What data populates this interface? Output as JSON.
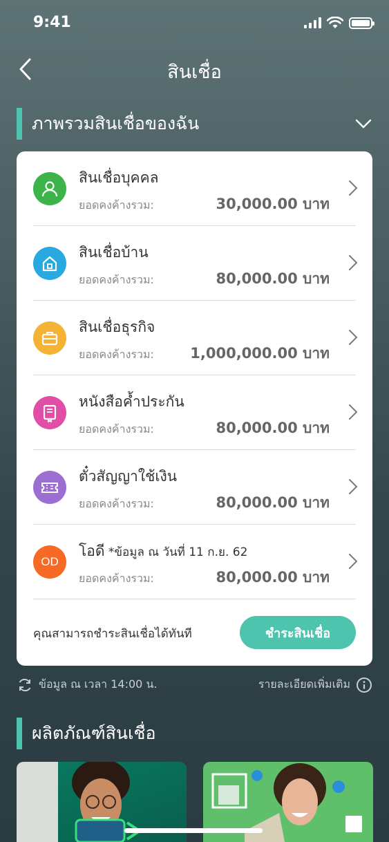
{
  "status_bar": {
    "time": "9:41"
  },
  "nav": {
    "title": "สินเชื่อ"
  },
  "overview": {
    "title": "ภาพรวมสินเชื่อของฉัน",
    "loans": [
      {
        "name": "สินเชื่อบุคคล",
        "note": "",
        "label": "ยอดคงค้างรวม:",
        "value": "30,000.00 บาท",
        "icon": "person-icon",
        "color": "#3db44a"
      },
      {
        "name": "สินเชื่อบ้าน",
        "note": "",
        "label": "ยอดคงค้างรวม:",
        "value": "80,000.00 บาท",
        "icon": "house-icon",
        "color": "#2aa9e0"
      },
      {
        "name": "สินเชื่อธุรกิจ",
        "note": "",
        "label": "ยอดคงค้างรวม:",
        "value": "1,000,000.00 บาท",
        "icon": "briefcase-icon",
        "color": "#f5b335"
      },
      {
        "name": "หนังสือค้ำประกัน",
        "note": "",
        "label": "ยอดคงค้างรวม:",
        "value": "80,000.00 บาท",
        "icon": "certificate-icon",
        "color": "#e04ea5"
      },
      {
        "name": "ตั๋วสัญญาใช้เงิน",
        "note": "",
        "label": "ยอดคงค้างรวม:",
        "value": "80,000.00 บาท",
        "icon": "ticket-icon",
        "color": "#9b6fd1"
      },
      {
        "name": "โอดี",
        "note": " *ข้อมูล ณ วันที่ 11 ก.ย. 62",
        "label": "ยอดคงค้างรวม:",
        "value": "80,000.00 บาท",
        "icon": "od-icon",
        "icon_text": "OD",
        "color": "#f76a25"
      }
    ],
    "pay_text": "คุณสามารถชำระสินเชื่อได้ทันที",
    "pay_button": "ชำระสินเชื่อ"
  },
  "info": {
    "updated": "ข้อมูล ณ เวลา 14:00 น.",
    "details": "รายละเอียดเพิ่มเติม"
  },
  "products": {
    "title": "ผลิตภัณฑ์สินเชื่อ"
  },
  "colors": {
    "accent": "#4ec3ad"
  }
}
